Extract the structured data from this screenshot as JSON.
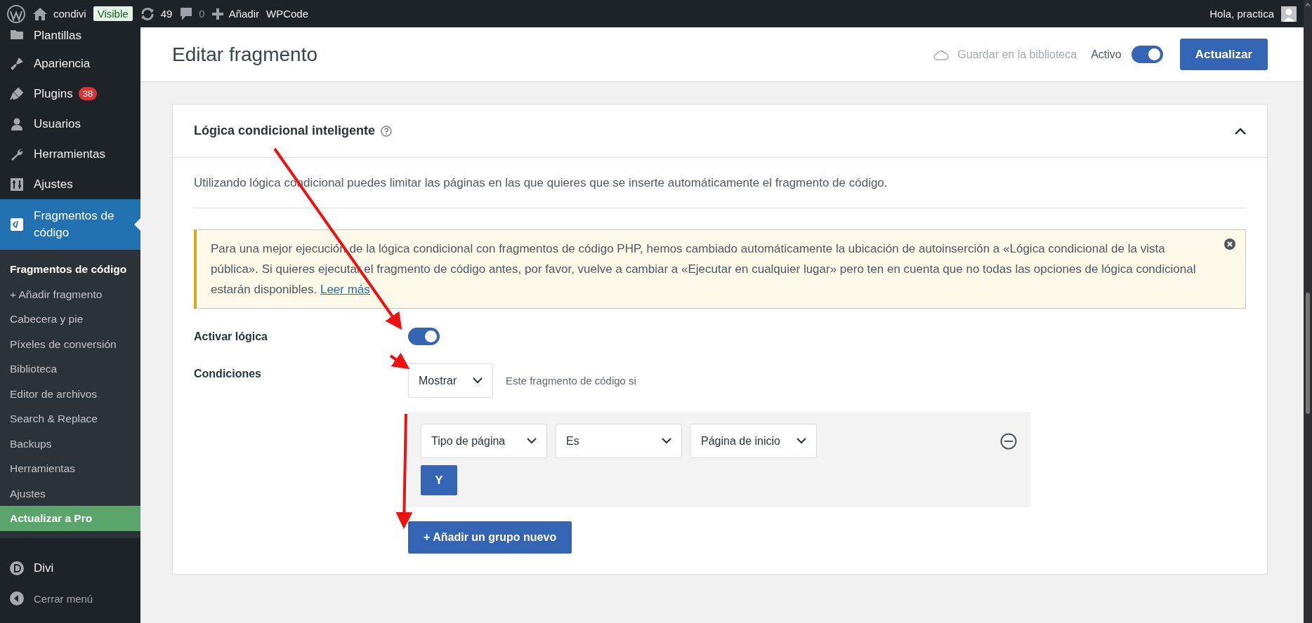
{
  "admin_bar": {
    "site": "condivi",
    "badge": "Visible",
    "updates": "49",
    "comments": "0",
    "new_label": "Añadir",
    "plugin_label": "WPCode",
    "greeting": "Hola, practica"
  },
  "sidebar": {
    "menu": [
      {
        "label": "Plantillas",
        "selected": false
      },
      {
        "label": "Apariencia",
        "selected": false
      },
      {
        "label": "Plugins",
        "badge": "38",
        "selected": false
      },
      {
        "label": "Usuarios",
        "selected": false
      },
      {
        "label": "Herramientas",
        "selected": false
      },
      {
        "label": "Ajustes",
        "selected": false
      },
      {
        "label": "Fragmentos de código",
        "selected": true
      }
    ],
    "submenu": [
      {
        "label": "Fragmentos de código",
        "selected": true,
        "kind": "link"
      },
      {
        "label": "+ Añadir fragmento",
        "selected": false,
        "kind": "link"
      },
      {
        "label": "Cabecera y pie",
        "selected": false,
        "kind": "link"
      },
      {
        "label": "Píxeles de conversión",
        "selected": false,
        "kind": "link"
      },
      {
        "label": "Biblioteca",
        "selected": false,
        "kind": "link"
      },
      {
        "label": "Editor de archivos",
        "selected": false,
        "kind": "link"
      },
      {
        "label": "Search & Replace",
        "selected": false,
        "kind": "link"
      },
      {
        "label": "Backups",
        "selected": false,
        "kind": "link"
      },
      {
        "label": "Herramientas",
        "selected": false,
        "kind": "link"
      },
      {
        "label": "Ajustes",
        "selected": false,
        "kind": "link"
      },
      {
        "label": "Actualizar a Pro",
        "selected": false,
        "kind": "upgrade"
      }
    ],
    "footer": [
      {
        "label": "Divi",
        "selected": false
      }
    ],
    "collapse_label": "Cerrar menú"
  },
  "header": {
    "title": "Editar fragmento",
    "save_library": {
      "label": "Guardar en la biblioteca",
      "disabled": true
    },
    "active_label": "Activo",
    "active_on": true,
    "update_button": "Actualizar"
  },
  "card": {
    "title": "Lógica condicional inteligente",
    "expanded": true,
    "description": "Utilizando lógica condicional puedes limitar las páginas en las que quieres que se inserte automáticamente el fragmento de código.",
    "notice": {
      "text": "Para una mejor ejecución de la lógica condicional con fragmentos de código PHP, hemos cambiado automáticamente la ubicación de autoinserción a «Lógica condicional de la vista pública». Si quieres ejecutar el fragmento de código antes, por favor, vuelve a cambiar a «Ejecutar en cualquier lugar» pero ten en cuenta que no todas las opciones de lógica condicional estarán disponibles.",
      "link": "Leer más"
    },
    "activate_label": "Activar lógica",
    "activate_on": true,
    "conditions_label": "Condiciones",
    "show_select": "Mostrar",
    "show_hint": "Este fragmento de código si",
    "groups": [
      {
        "rules": [
          {
            "field": "Tipo de página",
            "operator": "Es",
            "value": "Página de inicio"
          }
        ],
        "and_button": "Y"
      }
    ],
    "add_group_button": "+ Añadir un grupo nuevo"
  }
}
